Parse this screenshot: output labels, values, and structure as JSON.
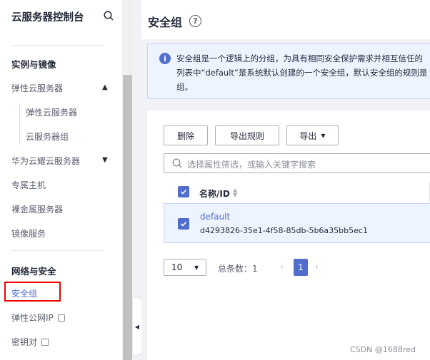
{
  "sidebar": {
    "title": "云服务器控制台",
    "group_instances": "实例与镜像",
    "items": {
      "ecs": "弹性云服务器",
      "ecs_sub": "弹性云服务器",
      "server_group": "云服务器组",
      "huawei_cloud": "华为云耀云服务器",
      "dedicated_host": "专属主机",
      "bare_metal": "裸金属服务器",
      "image_service": "镜像服务"
    },
    "group_network": "网络与安全",
    "network_items": {
      "security_group": "安全组",
      "eip": "弹性公网IP",
      "keypair": "密钥对"
    }
  },
  "header": {
    "title": "安全组",
    "help": "?"
  },
  "notice": {
    "icon": "i",
    "line1": "安全组是一个逻辑上的分组，为具有相同安全保护需求并相互信任的",
    "line2": "列表中“default”是系统默认创建的一个安全组，默认安全组的规则是",
    "line3": "组。"
  },
  "toolbar": {
    "delete": "删除",
    "export_rules": "导出规则",
    "export": "导出"
  },
  "search": {
    "placeholder": "选择属性筛选，或输入关键字搜索"
  },
  "table": {
    "column_name": "名称/ID",
    "rows": [
      {
        "name": "default",
        "id": "d4293826-35e1-4f58-85db-5b6a35bb5ec1"
      }
    ]
  },
  "pagination": {
    "page_size": "10",
    "total_label": "总条数：1",
    "current_page": "1"
  },
  "watermark": "CSDN @1688red",
  "colors": {
    "accent": "#526ecc",
    "highlight": "#e00000"
  }
}
